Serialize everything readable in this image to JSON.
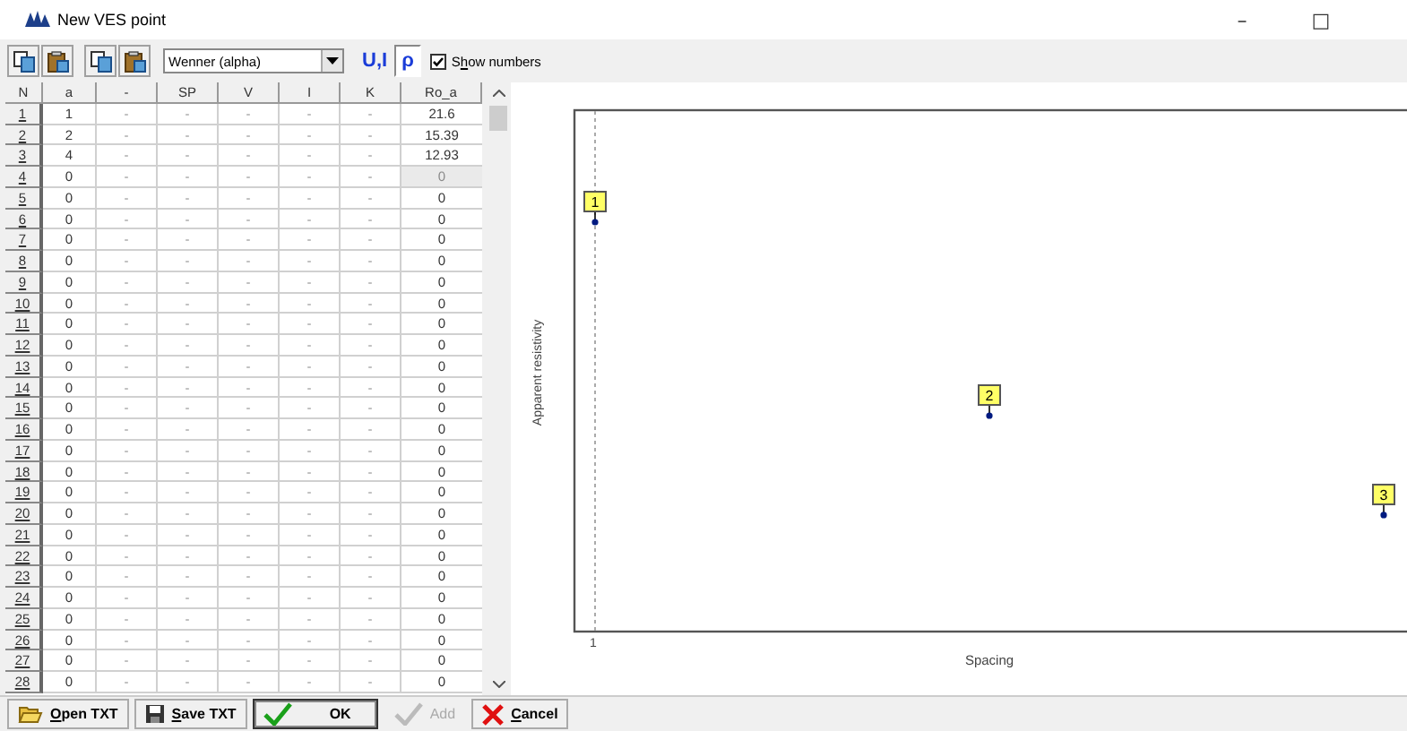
{
  "window": {
    "title": "New VES point",
    "controls": [
      "–",
      "□"
    ]
  },
  "toolbar": {
    "icon_buttons": [
      {
        "kind": "copy"
      },
      {
        "kind": "paste"
      },
      {
        "kind": "copy"
      },
      {
        "kind": "paste"
      }
    ],
    "array_select": {
      "value": "Wenner (alpha)"
    },
    "mode_buttons": [
      {
        "label": "U,I",
        "selected": false
      },
      {
        "label": "ρ",
        "selected": true
      }
    ],
    "show_numbers": {
      "before": "S",
      "key": "h",
      "rest": "ow numbers",
      "checked": true
    }
  },
  "grid": {
    "columns": [
      "N",
      "a",
      "-",
      "SP",
      "V",
      "I",
      "K",
      "Ro_a"
    ],
    "rows": [
      {
        "cells": [
          "1",
          "1",
          "-",
          "-",
          "-",
          "-",
          "-",
          "21.6"
        ],
        "ro_greyed": false
      },
      {
        "cells": [
          "2",
          "2",
          "-",
          "-",
          "-",
          "-",
          "-",
          "15.39"
        ],
        "ro_greyed": false
      },
      {
        "cells": [
          "3",
          "4",
          "-",
          "-",
          "-",
          "-",
          "-",
          "12.93"
        ],
        "ro_greyed": false
      },
      {
        "cells": [
          "4",
          "0",
          "-",
          "-",
          "-",
          "-",
          "-",
          "0"
        ],
        "ro_greyed": true
      },
      {
        "cells": [
          "5",
          "0",
          "-",
          "-",
          "-",
          "-",
          "-",
          "0"
        ],
        "ro_greyed": false
      },
      {
        "cells": [
          "6",
          "0",
          "-",
          "-",
          "-",
          "-",
          "-",
          "0"
        ],
        "ro_greyed": false
      },
      {
        "cells": [
          "7",
          "0",
          "-",
          "-",
          "-",
          "-",
          "-",
          "0"
        ],
        "ro_greyed": false
      },
      {
        "cells": [
          "8",
          "0",
          "-",
          "-",
          "-",
          "-",
          "-",
          "0"
        ],
        "ro_greyed": false
      },
      {
        "cells": [
          "9",
          "0",
          "-",
          "-",
          "-",
          "-",
          "-",
          "0"
        ],
        "ro_greyed": false
      },
      {
        "cells": [
          "10",
          "0",
          "-",
          "-",
          "-",
          "-",
          "-",
          "0"
        ],
        "ro_greyed": false
      },
      {
        "cells": [
          "11",
          "0",
          "-",
          "-",
          "-",
          "-",
          "-",
          "0"
        ],
        "ro_greyed": false
      },
      {
        "cells": [
          "12",
          "0",
          "-",
          "-",
          "-",
          "-",
          "-",
          "0"
        ],
        "ro_greyed": false
      },
      {
        "cells": [
          "13",
          "0",
          "-",
          "-",
          "-",
          "-",
          "-",
          "0"
        ],
        "ro_greyed": false
      },
      {
        "cells": [
          "14",
          "0",
          "-",
          "-",
          "-",
          "-",
          "-",
          "0"
        ],
        "ro_greyed": false
      },
      {
        "cells": [
          "15",
          "0",
          "-",
          "-",
          "-",
          "-",
          "-",
          "0"
        ],
        "ro_greyed": false
      },
      {
        "cells": [
          "16",
          "0",
          "-",
          "-",
          "-",
          "-",
          "-",
          "0"
        ],
        "ro_greyed": false
      },
      {
        "cells": [
          "17",
          "0",
          "-",
          "-",
          "-",
          "-",
          "-",
          "0"
        ],
        "ro_greyed": false
      },
      {
        "cells": [
          "18",
          "0",
          "-",
          "-",
          "-",
          "-",
          "-",
          "0"
        ],
        "ro_greyed": false
      },
      {
        "cells": [
          "19",
          "0",
          "-",
          "-",
          "-",
          "-",
          "-",
          "0"
        ],
        "ro_greyed": false
      },
      {
        "cells": [
          "20",
          "0",
          "-",
          "-",
          "-",
          "-",
          "-",
          "0"
        ],
        "ro_greyed": false
      },
      {
        "cells": [
          "21",
          "0",
          "-",
          "-",
          "-",
          "-",
          "-",
          "0"
        ],
        "ro_greyed": false
      },
      {
        "cells": [
          "22",
          "0",
          "-",
          "-",
          "-",
          "-",
          "-",
          "0"
        ],
        "ro_greyed": false
      },
      {
        "cells": [
          "23",
          "0",
          "-",
          "-",
          "-",
          "-",
          "-",
          "0"
        ],
        "ro_greyed": false
      },
      {
        "cells": [
          "24",
          "0",
          "-",
          "-",
          "-",
          "-",
          "-",
          "0"
        ],
        "ro_greyed": false
      },
      {
        "cells": [
          "25",
          "0",
          "-",
          "-",
          "-",
          "-",
          "-",
          "0"
        ],
        "ro_greyed": false
      },
      {
        "cells": [
          "26",
          "0",
          "-",
          "-",
          "-",
          "-",
          "-",
          "0"
        ],
        "ro_greyed": false
      },
      {
        "cells": [
          "27",
          "0",
          "-",
          "-",
          "-",
          "-",
          "-",
          "0"
        ],
        "ro_greyed": false
      },
      {
        "cells": [
          "28",
          "0",
          "-",
          "-",
          "-",
          "-",
          "-",
          "0"
        ],
        "ro_greyed": false
      }
    ]
  },
  "plot": {
    "ylabel": "Apparent resistivity",
    "xlabel": "Spacing",
    "xtick": "1",
    "points": [
      {
        "label": "1"
      },
      {
        "label": "2"
      },
      {
        "label": "3"
      }
    ]
  },
  "buttons": [
    {
      "kind": "open",
      "key": "O",
      "rest": "pen TXT",
      "disabled": false,
      "default": false
    },
    {
      "kind": "save",
      "key": "S",
      "rest": "ave TXT",
      "disabled": false,
      "default": false
    },
    {
      "kind": "ok",
      "rest": "OK",
      "disabled": false,
      "default": true
    },
    {
      "kind": "add",
      "rest": "Add",
      "disabled": true,
      "default": false
    },
    {
      "kind": "cancel",
      "key": "C",
      "rest": "ancel",
      "disabled": false,
      "default": false
    }
  ]
}
